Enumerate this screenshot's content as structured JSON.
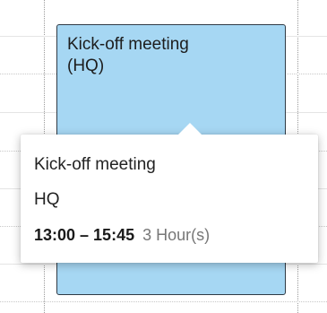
{
  "event": {
    "title": "Kick-off meeting\n(HQ)",
    "color": "#a6d7f3"
  },
  "tooltip": {
    "title": "Kick-off meeting",
    "location": "HQ",
    "time_range": "13:00 – 15:45",
    "duration": "3 Hour(s)"
  }
}
